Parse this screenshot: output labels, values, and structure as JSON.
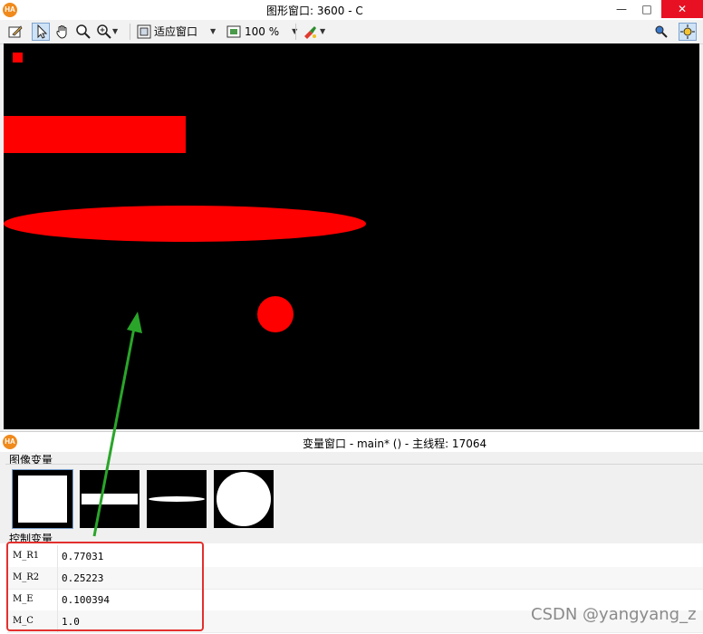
{
  "graphics_window": {
    "title": "图形窗口: 3600 - C",
    "logo": "HA",
    "controls": [
      "—",
      "□",
      "✕"
    ]
  },
  "toolbar": {
    "fit_window_label": "适应窗口",
    "zoom_label": "100 %"
  },
  "variable_window": {
    "title": "变量窗口 - main* () - 主线程: 17064",
    "logo": "HA",
    "image_vars_label": "图像变量",
    "control_vars_label": "控制变量",
    "control_vars": [
      {
        "name": "M_R1",
        "value": "0.77031"
      },
      {
        "name": "M_R2",
        "value": "0.25223"
      },
      {
        "name": "M_E",
        "value": "0.100394"
      },
      {
        "name": "M_C",
        "value": "1.0"
      }
    ]
  },
  "watermark": "CSDN @yangyang_z",
  "colors": {
    "shape_fill": "#ff0000",
    "canvas_bg": "#000000",
    "arrow": "#2aa52a",
    "highlight_box": "#e3302e"
  },
  "icons": [
    "edit-icon",
    "pointer-icon",
    "hand-icon",
    "zoom-icon",
    "zoom-in-icon",
    "fit-window-icon",
    "zoom-percent-icon",
    "paint-icon",
    "inspect-icon",
    "settings-icon"
  ]
}
